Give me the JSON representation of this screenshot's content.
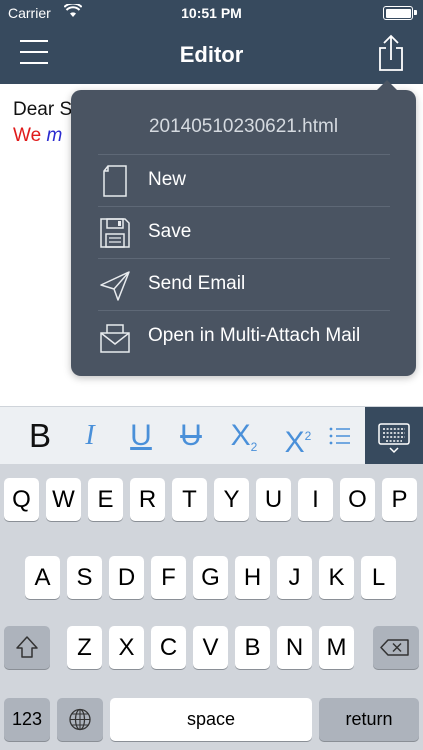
{
  "status_bar": {
    "carrier": "Carrier",
    "time": "10:51 PM"
  },
  "nav": {
    "title": "Editor"
  },
  "editor": {
    "line1": "Dear S",
    "line2_plain": "We ",
    "line2_italic": "m"
  },
  "popover": {
    "filename": "20140510230621.html",
    "items": [
      {
        "label": "New",
        "icon": "document-icon"
      },
      {
        "label": "Save",
        "icon": "floppy-disk-icon"
      },
      {
        "label": "Send Email",
        "icon": "paper-plane-icon"
      },
      {
        "label": "Open in Multi-Attach Mail",
        "icon": "inbox-tray-icon"
      }
    ]
  },
  "format_toolbar": {
    "bold": "B",
    "italic": "I",
    "underline": "U",
    "strikethrough": "U",
    "subscript": "X",
    "subscript_mark": "2",
    "superscript": "X",
    "superscript_mark": "2"
  },
  "keyboard": {
    "row1": [
      "Q",
      "W",
      "E",
      "R",
      "T",
      "Y",
      "U",
      "I",
      "O",
      "P"
    ],
    "row2": [
      "A",
      "S",
      "D",
      "F",
      "G",
      "H",
      "J",
      "K",
      "L"
    ],
    "row3": [
      "Z",
      "X",
      "C",
      "V",
      "B",
      "N",
      "M"
    ],
    "numbers": "123",
    "space": "space",
    "return": "return"
  },
  "colors": {
    "bar": "#374a5e",
    "popover": "#4a5462",
    "accent": "#4a90d9",
    "red_text": "#e01b1b",
    "blue_text": "#2a2ad0"
  }
}
